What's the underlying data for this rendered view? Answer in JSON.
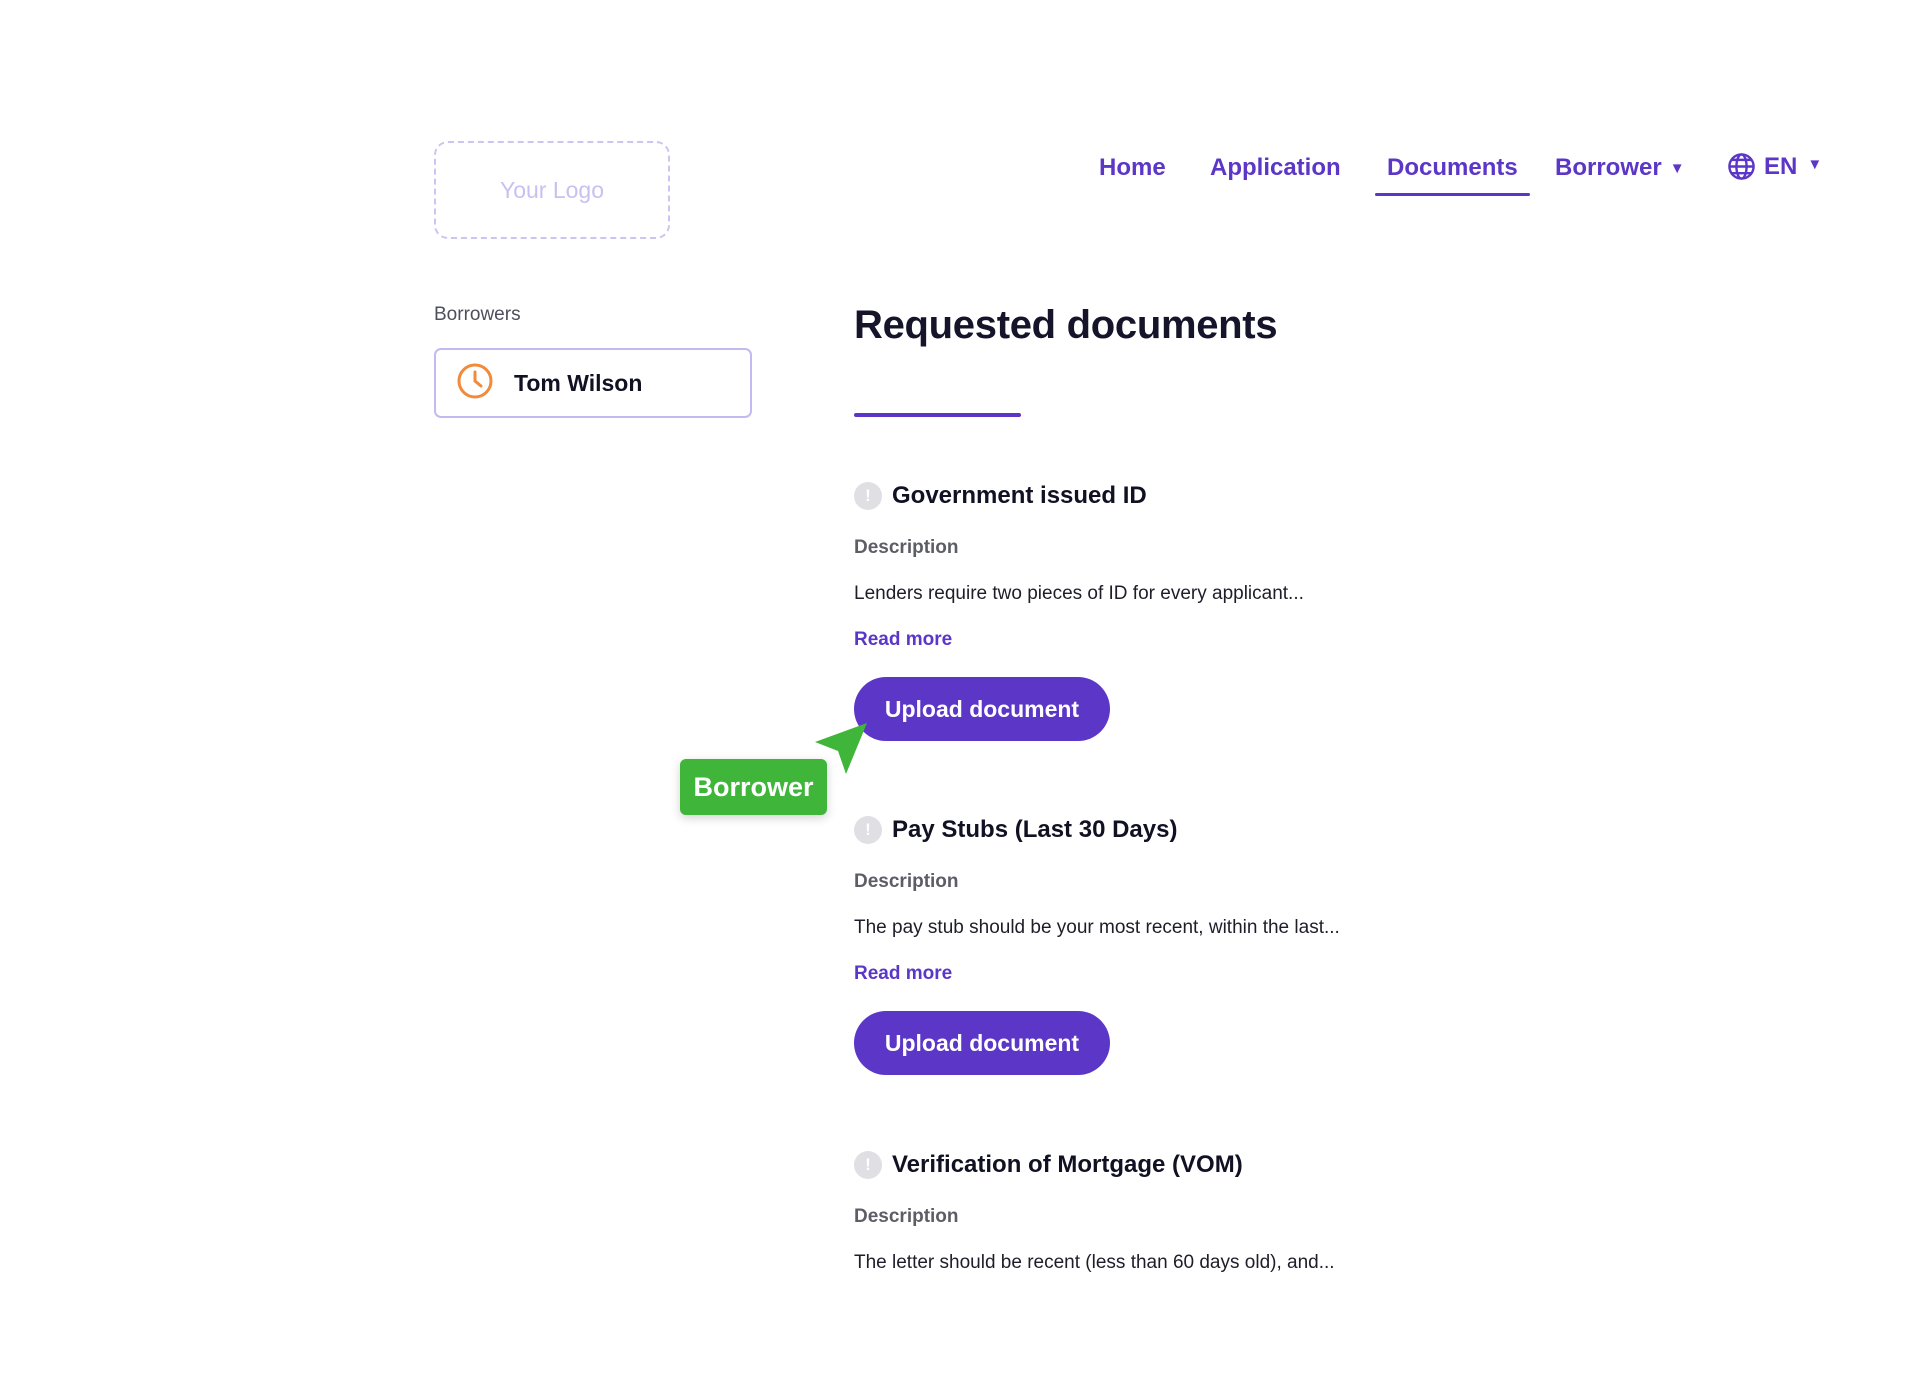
{
  "header": {
    "logo_text": "Your Logo",
    "nav": [
      {
        "label": "Home"
      },
      {
        "label": "Application"
      },
      {
        "label": "Documents"
      },
      {
        "label": "Borrower"
      }
    ],
    "language": "EN",
    "accent_color": "#5b36c7"
  },
  "sidebar": {
    "label": "Borrowers",
    "borrowers": [
      {
        "name": "Tom Wilson",
        "status_icon": "clock-icon"
      }
    ]
  },
  "main": {
    "title": "Requested documents",
    "documents": [
      {
        "title": "Government issued ID",
        "status_icon": "exclamation-icon",
        "description_label": "Description",
        "description": "Lenders require two pieces of ID for every applicant...",
        "read_more": "Read more",
        "upload_label": "Upload document"
      },
      {
        "title": "Pay Stubs (Last 30 Days)",
        "status_icon": "exclamation-icon",
        "description_label": "Description",
        "description": "The pay stub should be your most recent, within the last...",
        "read_more": "Read more",
        "upload_label": "Upload document"
      },
      {
        "title": "Verification of Mortgage (VOM)",
        "status_icon": "exclamation-icon",
        "description_label": "Description",
        "description": "The letter should be recent (less than 60 days old), and..."
      }
    ]
  },
  "cursor": {
    "label": "Borrower",
    "color": "#3fb53a"
  }
}
